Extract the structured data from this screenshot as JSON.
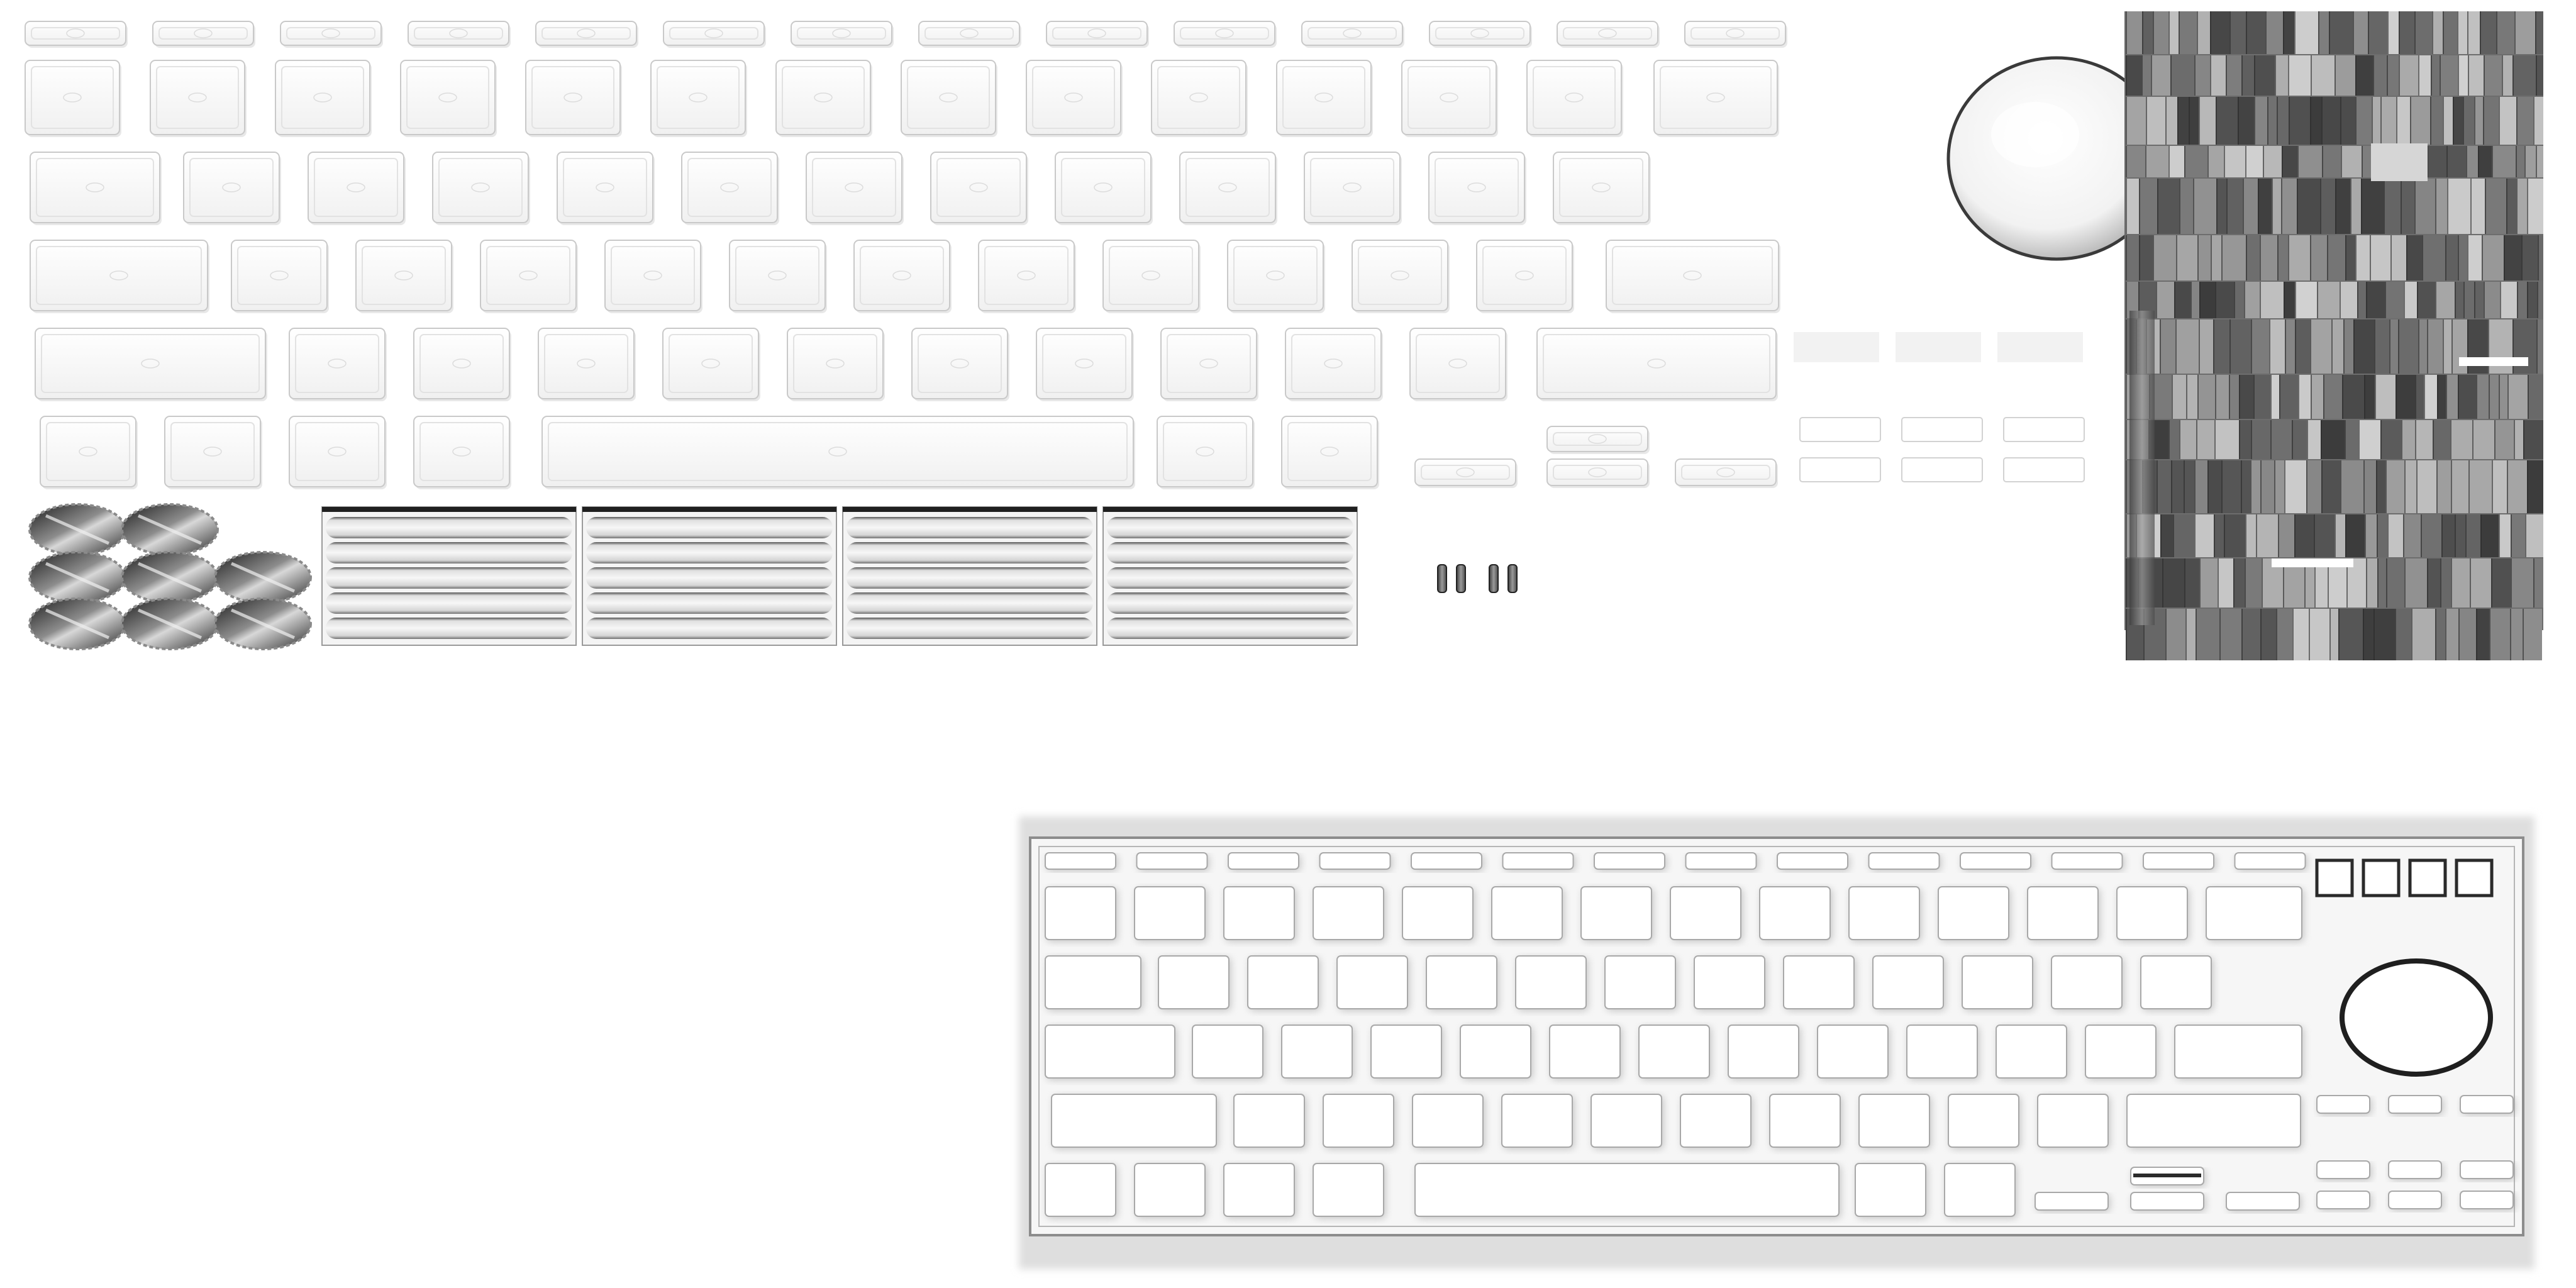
{
  "texture": {
    "background": "#ffffff",
    "key_fill": "#fbfbfb",
    "key_edge": "#c9c9c9",
    "dark": "#2a2a2a",
    "mid": "#8a8a8a",
    "panel_fill": "#f6f6f6"
  },
  "atlas_sections": [
    "keycap-strip",
    "trackball-cap",
    "vertical-bars-panel",
    "round-caps",
    "ribbed-panels",
    "small-pins",
    "keyboard-layout-preview"
  ]
}
